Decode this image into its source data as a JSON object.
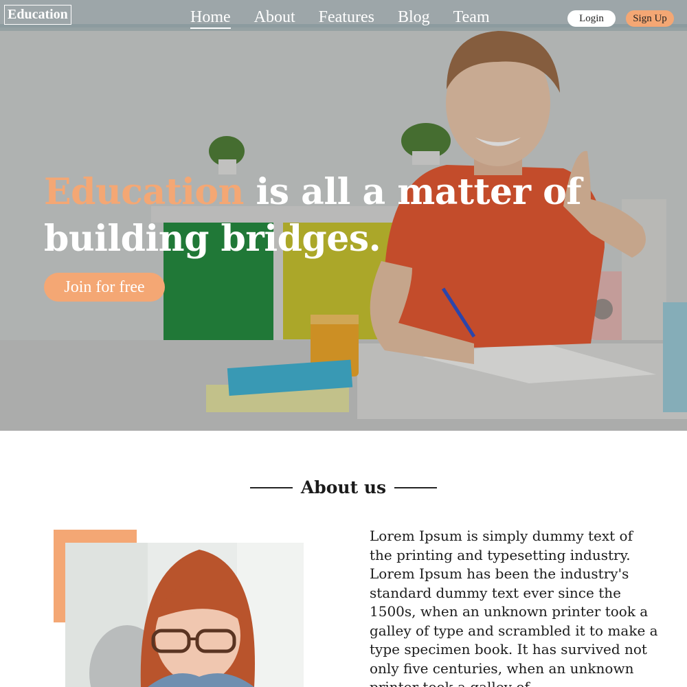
{
  "header": {
    "brand": "Education",
    "nav": [
      "Home",
      "About",
      "Features",
      "Blog",
      "Team"
    ],
    "active_nav": "Home",
    "login_label": "Login",
    "signup_label": "Sign Up"
  },
  "hero": {
    "headline_accent": "Education",
    "headline_rest": " is all a matter of building bridges.",
    "cta_label": "Join for free"
  },
  "about": {
    "title": "About us",
    "body": "Lorem Ipsum is simply dummy text of the printing and typesetting industry. Lorem Ipsum has been the industry's standard dummy text ever since the 1500s, when an unknown printer took a galley of type and scrambled it to make a type specimen book. It has survived not only five centuries, when an unknown printer took a galley of"
  },
  "colors": {
    "accent": "#f4a774",
    "text_dark": "#1b1b1b",
    "white": "#ffffff"
  }
}
